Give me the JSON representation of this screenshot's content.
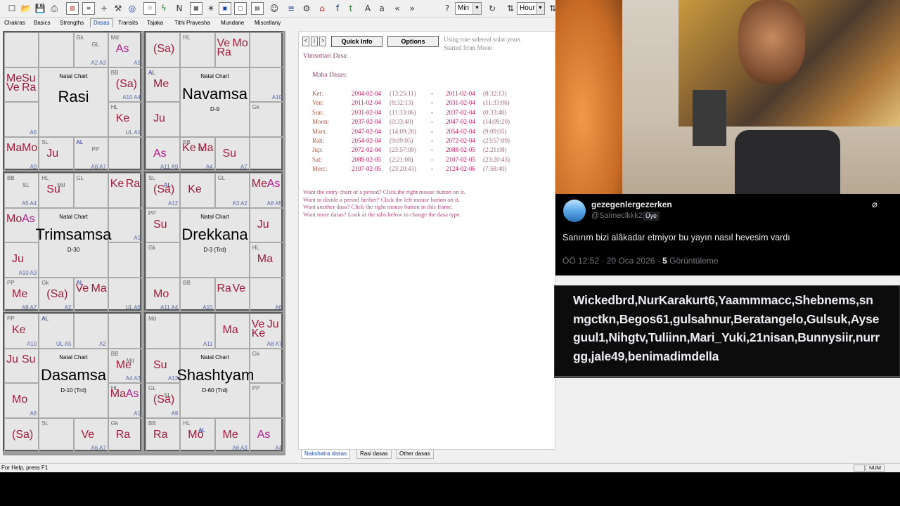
{
  "toolbar": {
    "combo_min": "Min",
    "combo_hour": "Hour",
    "icons": [
      "new-file-icon",
      "open-folder-icon",
      "save-icon",
      "print-icon",
      "chart-icon",
      "data-icon",
      "divide-icon",
      "tools-icon",
      "globe-icon",
      "sph-icon",
      "lightning-icon",
      "n-icon",
      "grid-icon",
      "sun-icon",
      "sb-icon",
      "frame-icon",
      "table-icon",
      "people-icon",
      "book-icon",
      "gear-icon",
      "temple-icon",
      "facebook-icon",
      "twitter-icon",
      "font-large-icon",
      "font-small-icon",
      "back-icon",
      "forward-icon",
      "help-icon",
      "animate-icon"
    ]
  },
  "tabs": [
    "Chakras",
    "Basics",
    "Strengths",
    "Dasas",
    "Transits",
    "Tajaka",
    "Tithi Pravesha",
    "Mundane",
    "Miscellany"
  ],
  "active_tab": "Dasas",
  "charts": [
    {
      "label": "Natal Chart",
      "name": "Rasi",
      "sub": "",
      "cells": [
        {
          "big": [],
          "sm": [],
          "a": ""
        },
        {
          "big": [],
          "sm": [],
          "a": ""
        },
        {
          "big": [],
          "sm": [
            "Gk",
            "GL"
          ],
          "a": "A2 A3"
        },
        {
          "big": [
            "As"
          ],
          "sm": [
            "Md"
          ],
          "a": "A5"
        },
        {
          "big": [
            "Me",
            "Su",
            "Ve",
            "Ra"
          ],
          "sm": [],
          "a": ""
        },
        {
          "big": [
            "(Sa)"
          ],
          "sm": [
            "BB"
          ],
          "a": "A10 A4"
        },
        {
          "big": [],
          "sm": [],
          "a": "A6"
        },
        {
          "big": [
            "Ke"
          ],
          "sm": [
            "HL"
          ],
          "a": "UL A1"
        },
        {
          "big": [
            "Ma",
            "Mo"
          ],
          "sm": [],
          "a": "A9"
        },
        {
          "big": [
            "Ju"
          ],
          "sm": [
            "SL"
          ],
          "a": ""
        },
        {
          "big": [],
          "sm": [
            "AL",
            "PP"
          ],
          "a": "A8 A7"
        },
        {
          "big": [],
          "sm": [],
          "a": ""
        }
      ]
    },
    {
      "label": "Natal Chart",
      "name": "Navamsa",
      "sub": "D-9",
      "cells": [
        {
          "big": [
            "(Sa)"
          ],
          "sm": [],
          "a": ""
        },
        {
          "big": [],
          "sm": [
            "HL"
          ],
          "a": ""
        },
        {
          "big": [
            "Ve",
            "Mo",
            "Ra"
          ],
          "sm": [],
          "a": ""
        },
        {
          "big": [],
          "sm": [],
          "a": ""
        },
        {
          "big": [
            "Me"
          ],
          "sm": [
            "AL"
          ],
          "a": ""
        },
        {
          "big": [],
          "sm": [],
          "a": "A10"
        },
        {
          "big": [
            "Ju"
          ],
          "sm": [],
          "a": ""
        },
        {
          "big": [],
          "sm": [
            "Gk"
          ],
          "a": ""
        },
        {
          "big": [
            "As"
          ],
          "sm": [],
          "a": "A11 A9"
        },
        {
          "big": [
            "Ke",
            "Ma"
          ],
          "sm": [
            "BB",
            "SL",
            "Md"
          ],
          "a": "A4"
        },
        {
          "big": [
            "Su"
          ],
          "sm": [],
          "a": "A7"
        },
        {
          "big": [],
          "sm": [],
          "a": ""
        }
      ]
    },
    {
      "label": "Natal Chart",
      "name": "Trimsamsa",
      "sub": "D-30",
      "cells": [
        {
          "big": [],
          "sm": [
            "BB",
            "SL"
          ],
          "a": "A5 A4"
        },
        {
          "big": [
            "Su"
          ],
          "sm": [
            "HL",
            "Md"
          ],
          "a": ""
        },
        {
          "big": [],
          "sm": [
            "GL"
          ],
          "a": ""
        },
        {
          "big": [
            "Ke",
            "Ra"
          ],
          "sm": [],
          "a": ""
        },
        {
          "big": [
            "Mo",
            "As"
          ],
          "sm": [],
          "a": ""
        },
        {
          "big": [],
          "sm": [],
          "a": "A1"
        },
        {
          "big": [
            "Ju"
          ],
          "sm": [],
          "a": "A10 A3"
        },
        {
          "big": [],
          "sm": [],
          "a": ""
        },
        {
          "big": [
            "Me"
          ],
          "sm": [
            "PP"
          ],
          "a": "A8 A7"
        },
        {
          "big": [
            "(Sa)"
          ],
          "sm": [
            "Gk"
          ],
          "a": "A2"
        },
        {
          "big": [
            "Ve",
            "Ma"
          ],
          "sm": [
            "AL"
          ],
          "a": ""
        },
        {
          "big": [],
          "sm": [],
          "a": "UL A6"
        }
      ]
    },
    {
      "label": "Natal Chart",
      "name": "Drekkana",
      "sub": "D-3 (Trd)",
      "cells": [
        {
          "big": [
            "(Sa)"
          ],
          "sm": [
            "SL",
            "AL"
          ],
          "a": "A12"
        },
        {
          "big": [
            "Ke"
          ],
          "sm": [],
          "a": ""
        },
        {
          "big": [],
          "sm": [
            "GL"
          ],
          "a": "A3 A2"
        },
        {
          "big": [
            "Me",
            "As"
          ],
          "sm": [],
          "a": "A8 A5"
        },
        {
          "big": [
            "Su"
          ],
          "sm": [
            "PP"
          ],
          "a": ""
        },
        {
          "big": [
            "Ju"
          ],
          "sm": [],
          "a": ""
        },
        {
          "big": [],
          "sm": [
            "Gk"
          ],
          "a": ""
        },
        {
          "big": [
            "Ma"
          ],
          "sm": [
            "HL"
          ],
          "a": ""
        },
        {
          "big": [
            "Mo"
          ],
          "sm": [],
          "a": "A11 A4"
        },
        {
          "big": [],
          "sm": [
            "BB"
          ],
          "a": "A10"
        },
        {
          "big": [
            "Ra",
            "Ve"
          ],
          "sm": [],
          "a": ""
        },
        {
          "big": [],
          "sm": [],
          "a": "A6"
        }
      ]
    },
    {
      "label": "Natal Chart",
      "name": "Dasamsa",
      "sub": "D-10 (Trd)",
      "cells": [
        {
          "big": [
            "Ke"
          ],
          "sm": [
            "PP"
          ],
          "a": "A10"
        },
        {
          "big": [],
          "sm": [
            "AL"
          ],
          "a": "UL A5"
        },
        {
          "big": [],
          "sm": [],
          "a": "A2"
        },
        {
          "big": [],
          "sm": [],
          "a": ""
        },
        {
          "big": [
            "Ju",
            "Su"
          ],
          "sm": [],
          "a": ""
        },
        {
          "big": [
            "Me"
          ],
          "sm": [
            "BB",
            "Md"
          ],
          "a": "A4 A3"
        },
        {
          "big": [
            "Mo"
          ],
          "sm": [],
          "a": "A8"
        },
        {
          "big": [
            "Ma",
            "As"
          ],
          "sm": [
            "HL"
          ],
          "a": "A1"
        },
        {
          "big": [
            "(Sa)"
          ],
          "sm": [],
          "a": ""
        },
        {
          "big": [],
          "sm": [
            "SL"
          ],
          "a": ""
        },
        {
          "big": [
            "Ve"
          ],
          "sm": [],
          "a": "A6 A7"
        },
        {
          "big": [
            "Ra"
          ],
          "sm": [
            "Gk"
          ],
          "a": ""
        }
      ]
    },
    {
      "label": "Natal Chart",
      "name": "Shashtyamsa",
      "sub": "D-60 (Trd)",
      "cells": [
        {
          "big": [],
          "sm": [
            "Md"
          ],
          "a": ""
        },
        {
          "big": [],
          "sm": [],
          "a": "A11"
        },
        {
          "big": [
            "Ma"
          ],
          "sm": [],
          "a": ""
        },
        {
          "big": [
            "Ve",
            "Ju",
            "Ke"
          ],
          "sm": [],
          "a": "A8 A7"
        },
        {
          "big": [
            "Su"
          ],
          "sm": [],
          "a": "A12"
        },
        {
          "big": [],
          "sm": [
            "Gk"
          ],
          "a": ""
        },
        {
          "big": [
            "(Sa)"
          ],
          "sm": [
            "GL",
            "SL"
          ],
          "a": "A9"
        },
        {
          "big": [],
          "sm": [
            "PP"
          ],
          "a": ""
        },
        {
          "big": [
            "Ra"
          ],
          "sm": [
            "BB"
          ],
          "a": ""
        },
        {
          "big": [
            "Mo"
          ],
          "sm": [
            "HL",
            "AL"
          ],
          "a": ""
        },
        {
          "big": [
            "Me"
          ],
          "sm": [],
          "a": "A6 A3"
        },
        {
          "big": [
            "As"
          ],
          "sm": [],
          "a": "A4"
        }
      ]
    }
  ],
  "dasa": {
    "nav": [
      "<",
      "|",
      ">"
    ],
    "quick_info": "Quick Info",
    "options": "Options",
    "note1": "Using true sidereal solar years",
    "note2": "Started from Moon",
    "title": "Vimsottari Dasa:",
    "subtitle": "Maha Dasas:",
    "rows": [
      {
        "planet": "Ket:",
        "start": "2004-02-04",
        "st": "(13:25:11)",
        "end": "2011-02-04",
        "et": "(8:32:13)"
      },
      {
        "planet": "Ven:",
        "start": "2011-02-04",
        "st": "(8:32:13)",
        "end": "2031-02-04",
        "et": "(11:33:06)"
      },
      {
        "planet": "Sun:",
        "start": "2031-02-04",
        "st": "(11:33:06)",
        "end": "2037-02-04",
        "et": "(0:33:40)"
      },
      {
        "planet": "Moon:",
        "start": "2037-02-04",
        "st": "(0:33:40)",
        "end": "2047-02-04",
        "et": "(14:09:20)"
      },
      {
        "planet": "Mars:",
        "start": "2047-02-04",
        "st": "(14:09:20)",
        "end": "2054-02-04",
        "et": "(9:09:05)"
      },
      {
        "planet": "Rah:",
        "start": "2054-02-04",
        "st": "(9:09:05)",
        "end": "2072-02-04",
        "et": "(23:57:09)"
      },
      {
        "planet": "Jup:",
        "start": "2072-02-04",
        "st": "(23:57:09)",
        "end": "2088-02-05",
        "et": "(2:21:08)"
      },
      {
        "planet": "Sat:",
        "start": "2088-02-05",
        "st": "(2:21:08)",
        "end": "2107-02-05",
        "et": "(23:20:43)"
      },
      {
        "planet": "Merc:",
        "start": "2107-02-05",
        "st": "(23:20:43)",
        "end": "2124-02-06",
        "et": "(7:58:40)"
      }
    ],
    "dash": "-",
    "hints": [
      "Want the entry chart of a period? Click the right mouse button on it.",
      "Want to divide a period further? Click the left mouse button on it.",
      "Want another dasa? Click the right mouse button in this frame.",
      "Want more dasas? Look at the tabs below to change the dasa type."
    ]
  },
  "bottom_tabs": [
    "Nakshatra dasas",
    "Rasi dasas",
    "Other dasas"
  ],
  "status": {
    "text": "For Help, press F1",
    "num": "NUM"
  },
  "tweet": {
    "name": "gezegenlergezerken",
    "handle": "@Salmeclkkk2",
    "badge": "Üye",
    "text": "Sanırım bizi alâkadar etmiyor bu yayın nasıl hevesim vardı",
    "time": "ÖÖ 12:52 · 20 Oca 2026 ·",
    "views": "5",
    "views_label": "Görüntüleme"
  },
  "names_text": "Wickedbrd,NurKarakurt6,Yaammmacc,Shebnems,snmgctkn,Begos61,gulsahnur,Beratangelo,Gulsuk,Ayseguul1,Nihgtv,Tuliinn,Mari_Yuki,21nisan,Bunnysiir,nurrgg,jale49,benimadimdella"
}
